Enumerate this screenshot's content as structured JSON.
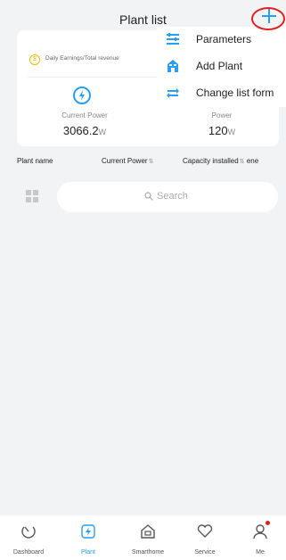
{
  "header": {
    "title": "Plant list"
  },
  "summary": {
    "earnings_label": "Daily Earnings/Total revenue",
    "earnings_symbol": "$",
    "current_power_label": "Current Power",
    "current_power_value": "3066.2",
    "current_power_unit": "W",
    "power_label": "Power",
    "power_value": "120",
    "power_unit": "W"
  },
  "menu": {
    "items": [
      {
        "label": "Parameters",
        "icon": "list-icon"
      },
      {
        "label": "Add Plant",
        "icon": "plant-icon"
      },
      {
        "label": "Change list form",
        "icon": "swap-icon"
      }
    ]
  },
  "columns": [
    {
      "label": "Plant name",
      "sortable": false
    },
    {
      "label": "Current Power",
      "sortable": true
    },
    {
      "label": "Capacity installed",
      "sortable": true
    },
    {
      "label": "ene",
      "sortable": false
    }
  ],
  "search": {
    "placeholder": "Search"
  },
  "nav": {
    "items": [
      {
        "label": "Dashboard",
        "icon": "dashboard-icon",
        "active": false
      },
      {
        "label": "Plant",
        "icon": "plant-bolt-icon",
        "active": true
      },
      {
        "label": "Smarthome",
        "icon": "home-icon",
        "active": false
      },
      {
        "label": "Service",
        "icon": "heart-icon",
        "active": false
      },
      {
        "label": "Me",
        "icon": "user-icon",
        "active": false,
        "badge": true
      }
    ]
  },
  "colors": {
    "accent": "#2a9df4",
    "highlight_ring": "#e02020",
    "earnings": "#f0b800"
  }
}
